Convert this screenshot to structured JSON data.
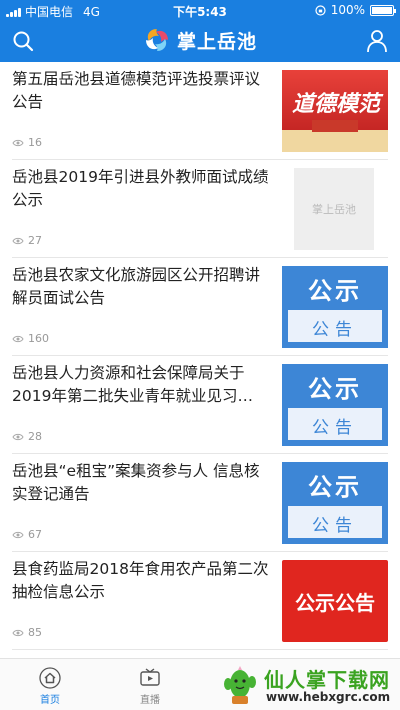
{
  "status_bar": {
    "carrier": "中国电信",
    "network": "4G",
    "time": "下午5:43",
    "battery": "100%"
  },
  "header": {
    "title": "掌上岳池",
    "search_icon": "search-icon",
    "user_icon": "user-icon"
  },
  "articles": [
    {
      "title": "第五届岳池县道德模范评选投票评议公告",
      "views": "16",
      "thumb_text": "道德模范"
    },
    {
      "title": "岳池县2019年引进县外教师面试成绩公示",
      "views": "27",
      "thumb_text": "掌上岳池"
    },
    {
      "title": "岳池县农家文化旅游园区公开招聘讲解员面试公告",
      "views": "160",
      "thumb_big": "公示",
      "thumb_small": "公告"
    },
    {
      "title": "岳池县人力资源和社会保障局关于2019年第二批失业青年就业见习…",
      "views": "28",
      "thumb_big": "公示",
      "thumb_small": "公告"
    },
    {
      "title": "岳池县“e租宝”案集资参与人 信息核实登记通告",
      "views": "67",
      "thumb_big": "公示",
      "thumb_small": "公告"
    },
    {
      "title": "县食药监局2018年食用农产品第二次抽检信息公示",
      "views": "85",
      "thumb_text": "公示公告"
    }
  ],
  "tabbar": {
    "tabs": [
      {
        "label": "首页",
        "icon": "home-icon"
      },
      {
        "label": "直播",
        "icon": "tv-icon"
      }
    ]
  },
  "watermark": {
    "title": "仙人掌下载网",
    "url": "www.hebxgrc.com"
  },
  "colors": {
    "brand": "#1a7fe0",
    "notice_red": "#e0261f",
    "notice_blue": "#3d86d6"
  }
}
